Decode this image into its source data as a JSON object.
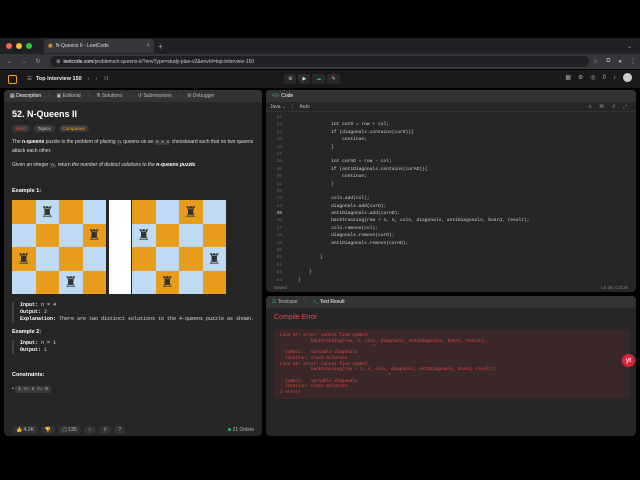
{
  "browser": {
    "tab_title": "N-Queens II - LeetCode",
    "url_host": "leetcode.com",
    "url_path": "/problems/n-queens-ii/?envType=study-plan-v2&envId=top-interview-150"
  },
  "topbar": {
    "list_title": "Top Interview 150",
    "run_label": "▶",
    "submit_label": "Submit",
    "streak": "0"
  },
  "left_tabs": [
    "Description",
    "Editorial",
    "Solutions",
    "Submissions",
    "Debugger"
  ],
  "problem": {
    "title": "52. N-Queens II",
    "tags": [
      "Hard",
      "Topics",
      "Companies"
    ],
    "para1_pre": "The ",
    "para1_bold": "n-queens",
    "para1_mid": " puzzle is the problem of placing ",
    "para1_code1": "n",
    "para1_mid2": " queens on an ",
    "para1_code2": "n x n",
    "para1_post": " chessboard such that no two queens attack each other.",
    "para2_pre": "Given an integer ",
    "para2_code": "n",
    "para2_mid": ", return ",
    "para2_em": "the number of distinct solutions to the ",
    "para2_bold": "n-queens puzzle",
    "para2_post": ".",
    "example1": {
      "heading": "Example 1:",
      "input_label": "Input:",
      "input": "n = 4",
      "output_label": "Output:",
      "output": "2",
      "explanation_label": "Explanation:",
      "explanation": "There are two distinct solutions to the 4-queens puzzle as shown."
    },
    "example2": {
      "heading": "Example 2:",
      "input_label": "Input:",
      "input": "n = 1",
      "output_label": "Output:",
      "output": "1"
    },
    "constraints_heading": "Constraints:",
    "constraint": "1 <= n <= 9"
  },
  "board": {
    "light_color": "#bfdaf4",
    "dark_color": "#e89c1c",
    "queen_glyph": "♜",
    "solution1_queens": [
      1,
      3,
      0,
      2
    ],
    "solution2_queens": [
      2,
      0,
      3,
      1
    ]
  },
  "left_footer": {
    "likes": "4.3K",
    "comments": "135",
    "online": "21 Online"
  },
  "code_panel": {
    "title": "Code",
    "language": "Java",
    "mode": "Auto",
    "saved": "Saved",
    "cursor": "Ln 45, Col 28",
    "current_line": "45",
    "lines": [
      {
        "n": "32",
        "t": ""
      },
      {
        "n": "33",
        "t": "            int curD = row + col;"
      },
      {
        "n": "34",
        "t": "            if (diagonals.contains(curD)){"
      },
      {
        "n": "35",
        "t": "                continue;"
      },
      {
        "n": "36",
        "t": "            }"
      },
      {
        "n": "37",
        "t": ""
      },
      {
        "n": "38",
        "t": "            int curAD = row - col;"
      },
      {
        "n": "39",
        "t": "            if (antiDiagonals.contains(curAD)){"
      },
      {
        "n": "40",
        "t": "                continue;"
      },
      {
        "n": "41",
        "t": "            }"
      },
      {
        "n": "42",
        "t": ""
      },
      {
        "n": "43",
        "t": "            cols.add(col);"
      },
      {
        "n": "44",
        "t": "            diagonals.add(curD);"
      },
      {
        "n": "45",
        "t": "            antiDiagonals.add(curAD);"
      },
      {
        "n": "46",
        "t": "            backtracking(row + 1, n, cols, diagonals, antiDiagonals, board, result);"
      },
      {
        "n": "47",
        "t": "            cols.remove(col);"
      },
      {
        "n": "48",
        "t": "            diagonals.remove(curD);"
      },
      {
        "n": "49",
        "t": "            antiDiagonals.remove(curAD);"
      },
      {
        "n": "50",
        "t": ""
      },
      {
        "n": "51",
        "t": "        }"
      },
      {
        "n": "52",
        "t": ""
      },
      {
        "n": "53",
        "t": "    }"
      },
      {
        "n": "54",
        "t": "}"
      }
    ]
  },
  "result_panel": {
    "tab1": "Testcase",
    "tab2": "Test Result",
    "status": "Compile Error",
    "error_text": "Line 17: error: cannot find symbol\n            backtracking(row, n, cols, diagonals, antiDiagonals, board, result);\n                                    ^\n  symbol:   variable diagonals\n  location: class Solution\nLine 46: error: cannot find symbol\n            backtracking(row + 1, n, cols, diagonals, antiDiagonals, board, result);\n                                          ^\n  symbol:   variable diagonals\n  location: class Solution\n2 errors"
  },
  "extension_badge": "yt"
}
